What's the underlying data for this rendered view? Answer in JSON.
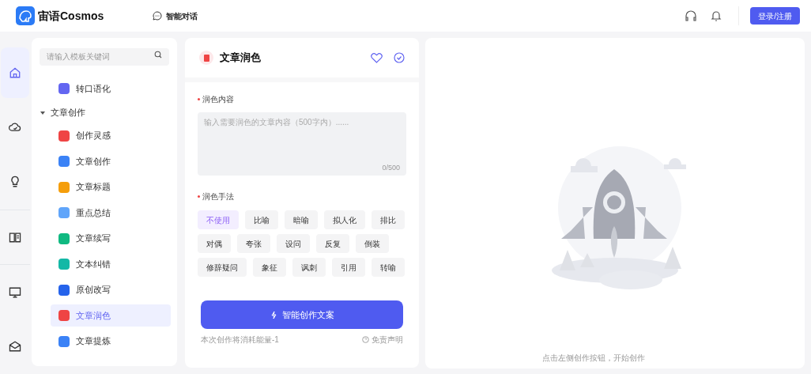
{
  "header": {
    "logo_text": "宙语Cosmos",
    "nav": [
      {
        "label": "智能对话",
        "selected": false
      }
    ],
    "login_button": "登录/注册"
  },
  "rail": [
    {
      "kind": "home",
      "selected": true
    },
    {
      "kind": "cloud",
      "selected": false
    },
    {
      "kind": "bulb",
      "selected": false
    },
    {
      "kind": "book",
      "selected": false
    },
    {
      "kind": "monitor",
      "selected": false
    },
    {
      "kind": "mail",
      "selected": false
    }
  ],
  "sidebar": {
    "search": {
      "placeholder": "请输入模板关键词"
    },
    "items": [
      {
        "label": "转口语化",
        "color": "#6366f1",
        "selected": false
      },
      {
        "label": "文章创作",
        "expanded": true,
        "children": [
          {
            "label": "创作灵感",
            "color": "#ef4444",
            "selected": false
          },
          {
            "label": "文章创作",
            "color": "#3b82f6",
            "selected": false
          },
          {
            "label": "文章标题",
            "color": "#f59e0b",
            "selected": false
          },
          {
            "label": "重点总结",
            "color": "#60a5fa",
            "selected": false
          },
          {
            "label": "文章续写",
            "color": "#10b981",
            "selected": false
          },
          {
            "label": "文本纠错",
            "color": "#14b8a6",
            "selected": false
          },
          {
            "label": "原创改写",
            "color": "#2563eb",
            "selected": false
          },
          {
            "label": "文章润色",
            "color": "#ef4444",
            "selected": true
          },
          {
            "label": "文章提炼",
            "color": "#3b82f6",
            "selected": false
          }
        ]
      }
    ]
  },
  "form": {
    "title": "文章润色",
    "content_label": "润色内容",
    "content": {
      "placeholder": "输入需要润色的文章内容（500字内）......",
      "counter": "0/500"
    },
    "method_label": "润色手法",
    "methods": [
      {
        "label": "不使用",
        "selected": true
      },
      {
        "label": "比喻",
        "selected": false
      },
      {
        "label": "暗喻",
        "selected": false
      },
      {
        "label": "拟人化",
        "selected": false
      },
      {
        "label": "排比",
        "selected": false
      },
      {
        "label": "对偶",
        "selected": false
      },
      {
        "label": "夸张",
        "selected": false
      },
      {
        "label": "设问",
        "selected": false
      },
      {
        "label": "反复",
        "selected": false
      },
      {
        "label": "倒装",
        "selected": false
      },
      {
        "label": "修辞疑问",
        "selected": false
      },
      {
        "label": "象征",
        "selected": false
      },
      {
        "label": "讽刺",
        "selected": false
      },
      {
        "label": "引用",
        "selected": false
      },
      {
        "label": "转喻",
        "selected": false
      }
    ],
    "submit_button": "智能创作文案",
    "cost_note": "本次创作将消耗能量-1",
    "disclaimer": "免责声明"
  },
  "result": {
    "hint": "点击左侧创作按钮，开始创作"
  }
}
